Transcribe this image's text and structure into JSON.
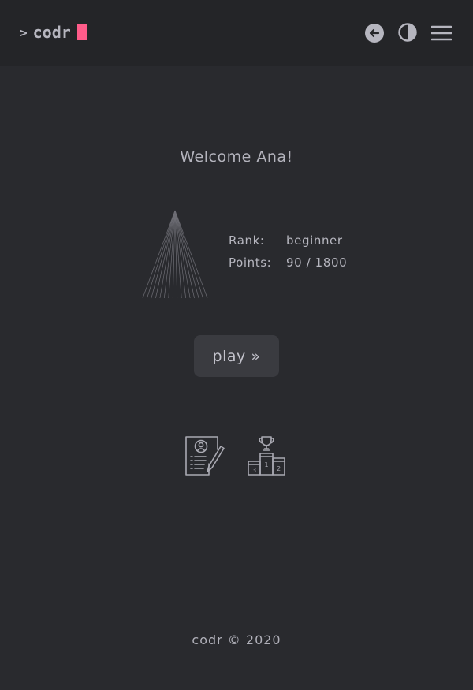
{
  "header": {
    "logo_prompt": ">",
    "logo_text": "codr",
    "accent_color": "#ff5c8a",
    "icons": [
      "back-arrow-icon",
      "contrast-icon",
      "hamburger-menu-icon"
    ]
  },
  "main": {
    "welcome": "Welcome Ana!",
    "rank_label": "Rank:",
    "rank_value": "beginner",
    "points_label": "Points:",
    "points_value": "90 / 1800",
    "play_label": "play »",
    "icons": [
      "profile-resume-icon",
      "leaderboard-podium-icon"
    ],
    "podium_labels": [
      "3",
      "1",
      "2"
    ]
  },
  "footer": {
    "text": "codr © 2020"
  }
}
